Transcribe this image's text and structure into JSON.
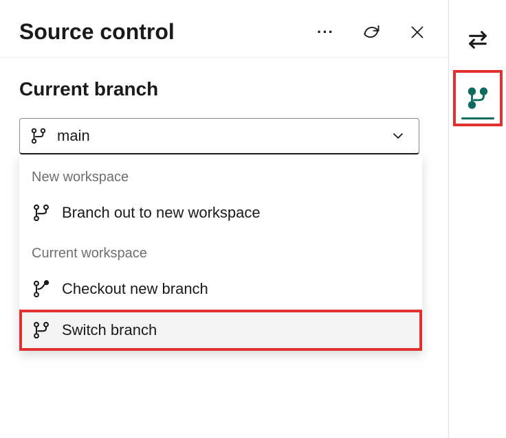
{
  "header": {
    "title": "Source control"
  },
  "section": {
    "heading": "Current branch"
  },
  "branch_select": {
    "value": "main"
  },
  "dropdown": {
    "group1_label": "New workspace",
    "branch_out_label": "Branch out to new workspace",
    "group2_label": "Current workspace",
    "checkout_label": "Checkout new branch",
    "switch_label": "Switch branch"
  },
  "colors": {
    "accent": "#0f6b5f",
    "highlight": "#e03030"
  }
}
